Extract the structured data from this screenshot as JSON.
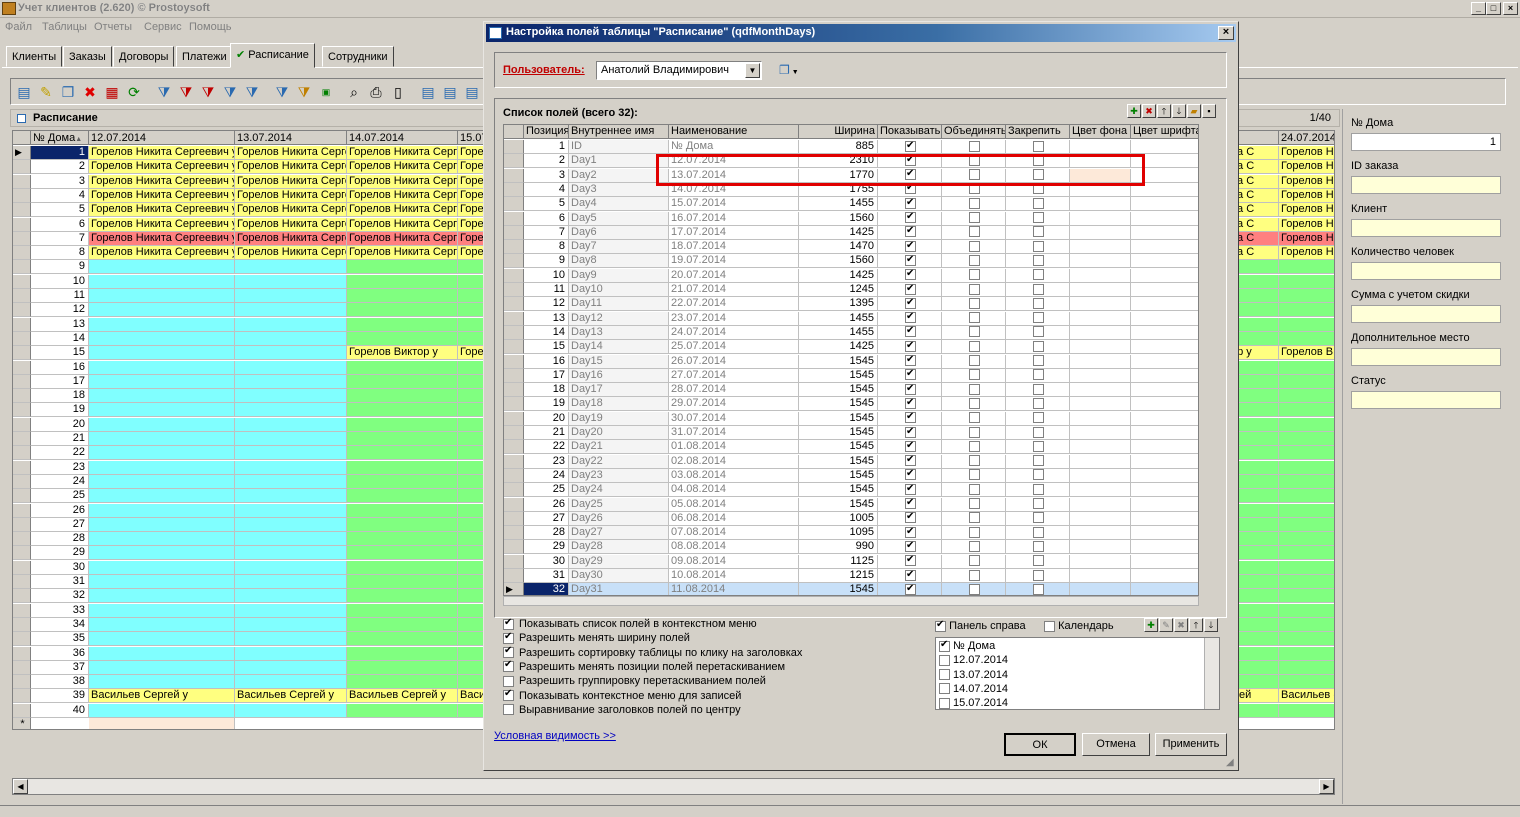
{
  "app": {
    "title": "Учет клиентов (2.620) © Prostoysoft",
    "controls": [
      "_",
      "□",
      "×"
    ]
  },
  "menu": [
    "Файл",
    "Таблицы",
    "Отчеты",
    "Сервис",
    "Помощь"
  ],
  "tabs": [
    "Клиенты",
    "Заказы",
    "Договоры",
    "Платежи",
    "Расписание",
    "Сотрудники"
  ],
  "active_tab_mark": "✔",
  "panel_title": "Расписание",
  "page_info": "1/40",
  "grid": {
    "headers": [
      "№ Дома",
      "12.07.2014",
      "13.07.2014",
      "14.07.2014",
      "15.07",
      "",
      "24.07.2014"
    ],
    "sort_mark": "▲",
    "new_row_mark": "*",
    "current_row_mark": "▶",
    "rows_count": 40,
    "names": {
      "gorelov": "Горелов Никита Сергеевич у",
      "gorelov_short": "Горелов Никита Серге",
      "gore": "Горе",
      "right_a": "икита С",
      "right_b": "Горелов Н",
      "viktor": "Горелов Виктор у",
      "viktor_r": "иктор у",
      "viktor_rb": "Горелов В",
      "vasiliev": "Васильев Сергей  у",
      "vasi": "Васи",
      "vasi_r": "Сергей",
      "vasi_rb": "Васильев ("
    }
  },
  "right_panel": {
    "fields": [
      {
        "label": "№ Дома",
        "value": "1"
      },
      {
        "label": "ID заказа",
        "value": ""
      },
      {
        "label": "Клиент",
        "value": ""
      },
      {
        "label": "Количество человек",
        "value": ""
      },
      {
        "label": "Сумма с учетом скидки",
        "value": ""
      },
      {
        "label": "Дополнительное место",
        "value": ""
      },
      {
        "label": "Статус",
        "value": ""
      }
    ]
  },
  "dialog": {
    "title": "Настройка полей таблицы \"Расписание\" (qdfMonthDays)",
    "close": "×",
    "user_label": "Пользователь:",
    "user_value": "Анатолий Владимирович",
    "fields_label": "Список полей (всего 32):",
    "headers": [
      "Позиция",
      "Внутреннее имя",
      "Наименование",
      "Ширина",
      "Показывать",
      "Объединять",
      "Закрепить",
      "Цвет фона",
      "Цвет шрифта"
    ],
    "rows": [
      {
        "pos": "1",
        "name": "ID",
        "title": "№ Дома",
        "width": "885"
      },
      {
        "pos": "2",
        "name": "Day1",
        "title": "12.07.2014",
        "width": "2310"
      },
      {
        "pos": "3",
        "name": "Day2",
        "title": "13.07.2014",
        "width": "1770"
      },
      {
        "pos": "4",
        "name": "Day3",
        "title": "14.07.2014",
        "width": "1755"
      },
      {
        "pos": "5",
        "name": "Day4",
        "title": "15.07.2014",
        "width": "1455"
      },
      {
        "pos": "6",
        "name": "Day5",
        "title": "16.07.2014",
        "width": "1560"
      },
      {
        "pos": "7",
        "name": "Day6",
        "title": "17.07.2014",
        "width": "1425"
      },
      {
        "pos": "8",
        "name": "Day7",
        "title": "18.07.2014",
        "width": "1470"
      },
      {
        "pos": "9",
        "name": "Day8",
        "title": "19.07.2014",
        "width": "1560"
      },
      {
        "pos": "10",
        "name": "Day9",
        "title": "20.07.2014",
        "width": "1425"
      },
      {
        "pos": "11",
        "name": "Day10",
        "title": "21.07.2014",
        "width": "1245"
      },
      {
        "pos": "12",
        "name": "Day11",
        "title": "22.07.2014",
        "width": "1395"
      },
      {
        "pos": "13",
        "name": "Day12",
        "title": "23.07.2014",
        "width": "1455"
      },
      {
        "pos": "14",
        "name": "Day13",
        "title": "24.07.2014",
        "width": "1455"
      },
      {
        "pos": "15",
        "name": "Day14",
        "title": "25.07.2014",
        "width": "1425"
      },
      {
        "pos": "16",
        "name": "Day15",
        "title": "26.07.2014",
        "width": "1545"
      },
      {
        "pos": "17",
        "name": "Day16",
        "title": "27.07.2014",
        "width": "1545"
      },
      {
        "pos": "18",
        "name": "Day17",
        "title": "28.07.2014",
        "width": "1545"
      },
      {
        "pos": "19",
        "name": "Day18",
        "title": "29.07.2014",
        "width": "1545"
      },
      {
        "pos": "20",
        "name": "Day19",
        "title": "30.07.2014",
        "width": "1545"
      },
      {
        "pos": "21",
        "name": "Day20",
        "title": "31.07.2014",
        "width": "1545"
      },
      {
        "pos": "22",
        "name": "Day21",
        "title": "01.08.2014",
        "width": "1545"
      },
      {
        "pos": "23",
        "name": "Day22",
        "title": "02.08.2014",
        "width": "1545"
      },
      {
        "pos": "24",
        "name": "Day23",
        "title": "03.08.2014",
        "width": "1545"
      },
      {
        "pos": "25",
        "name": "Day24",
        "title": "04.08.2014",
        "width": "1545"
      },
      {
        "pos": "26",
        "name": "Day25",
        "title": "05.08.2014",
        "width": "1545"
      },
      {
        "pos": "27",
        "name": "Day26",
        "title": "06.08.2014",
        "width": "1005"
      },
      {
        "pos": "28",
        "name": "Day27",
        "title": "07.08.2014",
        "width": "1095"
      },
      {
        "pos": "29",
        "name": "Day28",
        "title": "08.08.2014",
        "width": "990"
      },
      {
        "pos": "30",
        "name": "Day29",
        "title": "09.08.2014",
        "width": "1125"
      },
      {
        "pos": "31",
        "name": "Day30",
        "title": "10.08.2014",
        "width": "1215"
      },
      {
        "pos": "32",
        "name": "Day31",
        "title": "11.08.2014",
        "width": "1545"
      }
    ],
    "options": [
      {
        "label": "Показывать список полей в контекстном меню",
        "checked": true
      },
      {
        "label": "Разрешить менять ширину полей",
        "checked": true
      },
      {
        "label": "Разрешить сортировку таблицы по клику на заголовках",
        "checked": true
      },
      {
        "label": "Разрешить менять позиции полей перетаскиванием",
        "checked": true
      },
      {
        "label": "Разрешить группировку перетаскиванием полей",
        "checked": false
      },
      {
        "label": "Показывать контекстное меню для записей",
        "checked": true
      },
      {
        "label": "Выравнивание заголовков полей по центру",
        "checked": false
      }
    ],
    "panel_right_label": "Панель справа",
    "calendar_label": "Календарь",
    "panel_list": [
      {
        "label": "№ Дома",
        "checked": true
      },
      {
        "label": "12.07.2014",
        "checked": false
      },
      {
        "label": "13.07.2014",
        "checked": false
      },
      {
        "label": "14.07.2014",
        "checked": false
      },
      {
        "label": "15.07.2014",
        "checked": false
      }
    ],
    "cond_link": "Условная видимость >>",
    "ok": "ОК",
    "cancel": "Отмена",
    "apply": "Применить"
  },
  "colors": {
    "yellow": "#ffff80",
    "pink": "#ff8080",
    "cyan": "#80ffff",
    "green": "#80ff80",
    "peach": "#fde9d9",
    "highlight": "#e00000"
  }
}
